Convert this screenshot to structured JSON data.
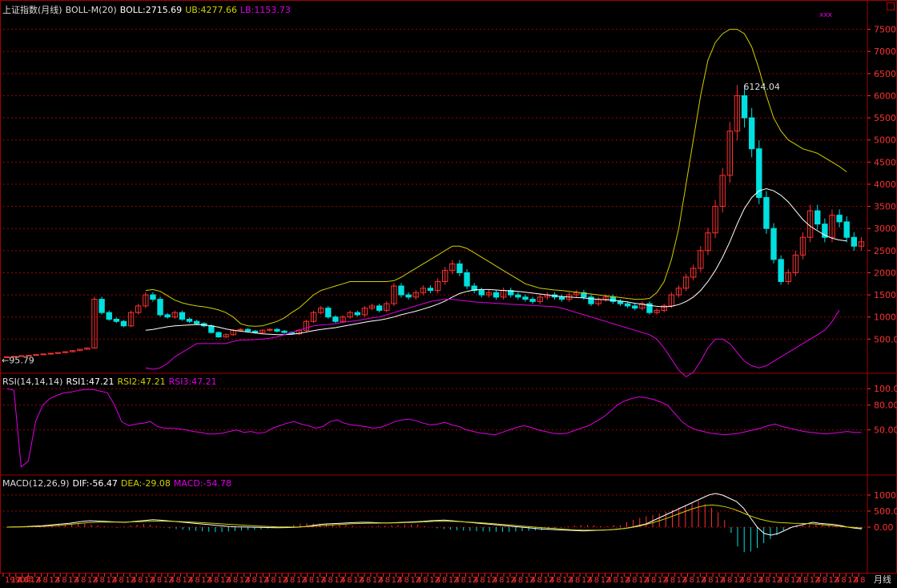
{
  "panes": {
    "main": {
      "title": "上证指数(月线)",
      "indicator": "BOLL-M(20)",
      "boll": "BOLL:2715.69",
      "ub": "UB:4277.66",
      "lb": "LB:1153.73",
      "high_label": "6124.04",
      "low_label": "←95.79",
      "tag": "xxx"
    },
    "rsi": {
      "title": "RSI(14,14,14)",
      "rsi1": "RSI1:47.21",
      "rsi2": "RSI2:47.21",
      "rsi3": "RSI3:47.21"
    },
    "macd": {
      "title": "MACD(12,26,9)",
      "dif": "DIF:-56.47",
      "dea": "DEA:-29.08",
      "macd": "MACD:-54.78"
    }
  },
  "colors": {
    "up": "#ff3030",
    "down": "#00e0e0",
    "boll": "#ffffff",
    "ub": "#d0d000",
    "lb": "#e000e0",
    "grid": "#a00000",
    "axis": "#ff3030"
  },
  "chart_data": [
    {
      "type": "candlestick",
      "pane": "main",
      "yticks": [
        500,
        1000,
        1500,
        2000,
        2500,
        3000,
        3500,
        4000,
        4500,
        5000,
        5500,
        6000,
        6500,
        7000,
        7500
      ],
      "ytick_labels": [
        "500.0",
        "1000",
        "1500",
        "2000",
        "2500",
        "3000",
        "3500",
        "4000",
        "4500",
        "5000",
        "5500",
        "6000",
        "6500",
        "7000",
        "7500"
      ],
      "ylim": [
        -200,
        7800
      ],
      "close": [
        100,
        110,
        125,
        135,
        150,
        165,
        180,
        195,
        215,
        240,
        270,
        300,
        1400,
        1100,
        950,
        900,
        800,
        1100,
        1250,
        1500,
        1400,
        1050,
        1000,
        1100,
        950,
        900,
        850,
        800,
        650,
        550,
        600,
        700,
        720,
        680,
        650,
        700,
        720,
        680,
        650,
        620,
        700,
        900,
        1100,
        1200,
        1000,
        900,
        1000,
        1100,
        1050,
        1200,
        1250,
        1150,
        1300,
        1700,
        1500,
        1450,
        1550,
        1650,
        1600,
        1800,
        2050,
        2200,
        2000,
        1700,
        1600,
        1500,
        1550,
        1450,
        1600,
        1500,
        1450,
        1400,
        1350,
        1450,
        1500,
        1450,
        1400,
        1500,
        1550,
        1450,
        1300,
        1400,
        1450,
        1350,
        1300,
        1250,
        1200,
        1300,
        1100,
        1150,
        1250,
        1500,
        1650,
        1900,
        2100,
        2500,
        2900,
        3500,
        4200,
        5200,
        6000,
        5500,
        4800,
        3700,
        3000,
        2300,
        1800,
        2000,
        2400,
        2800,
        3400,
        3100,
        2800,
        3300,
        3150,
        2800,
        2600,
        2700
      ],
      "boll": {
        "mid": [
          null,
          null,
          null,
          null,
          null,
          null,
          null,
          null,
          null,
          null,
          null,
          null,
          null,
          null,
          null,
          null,
          null,
          null,
          null,
          700,
          720,
          750,
          780,
          800,
          810,
          820,
          830,
          820,
          800,
          770,
          730,
          700,
          680,
          660,
          640,
          620,
          610,
          600,
          600,
          610,
          630,
          660,
          690,
          720,
          740,
          760,
          790,
          820,
          850,
          880,
          910,
          930,
          960,
          1000,
          1050,
          1090,
          1130,
          1180,
          1230,
          1290,
          1360,
          1450,
          1530,
          1580,
          1610,
          1620,
          1620,
          1610,
          1600,
          1590,
          1580,
          1560,
          1540,
          1520,
          1500,
          1480,
          1460,
          1450,
          1440,
          1430,
          1410,
          1400,
          1390,
          1380,
          1360,
          1340,
          1310,
          1290,
          1260,
          1240,
          1230,
          1240,
          1280,
          1350,
          1450,
          1600,
          1800,
          2050,
          2350,
          2700,
          3100,
          3450,
          3700,
          3850,
          3900,
          3850,
          3750,
          3600,
          3400,
          3200,
          3050,
          2950,
          2850,
          2780,
          2740,
          2720
        ],
        "ub": [
          null,
          null,
          null,
          null,
          null,
          null,
          null,
          null,
          null,
          null,
          null,
          null,
          null,
          null,
          null,
          null,
          null,
          null,
          null,
          1600,
          1620,
          1580,
          1480,
          1380,
          1320,
          1280,
          1250,
          1230,
          1200,
          1160,
          1100,
          1000,
          850,
          800,
          790,
          800,
          850,
          900,
          980,
          1100,
          1200,
          1350,
          1500,
          1600,
          1650,
          1700,
          1750,
          1800,
          1800,
          1800,
          1800,
          1800,
          1800,
          1820,
          1900,
          2000,
          2100,
          2200,
          2300,
          2400,
          2500,
          2600,
          2600,
          2550,
          2450,
          2350,
          2250,
          2150,
          2050,
          1950,
          1850,
          1750,
          1700,
          1650,
          1630,
          1610,
          1600,
          1580,
          1560,
          1540,
          1520,
          1500,
          1480,
          1460,
          1440,
          1420,
          1400,
          1400,
          1420,
          1550,
          1800,
          2300,
          3000,
          4000,
          5000,
          6000,
          6800,
          7200,
          7400,
          7500,
          7500,
          7400,
          7100,
          6600,
          6000,
          5500,
          5200,
          5000,
          4900,
          4800,
          4750,
          4700,
          4600,
          4500,
          4400,
          4280
        ],
        "lb": [
          null,
          null,
          null,
          null,
          null,
          null,
          null,
          null,
          null,
          null,
          null,
          null,
          null,
          null,
          null,
          null,
          null,
          null,
          null,
          -150,
          -180,
          -150,
          -50,
          100,
          200,
          300,
          400,
          400,
          400,
          400,
          400,
          450,
          480,
          480,
          490,
          500,
          520,
          550,
          600,
          650,
          700,
          750,
          800,
          820,
          830,
          850,
          880,
          900,
          920,
          950,
          980,
          1000,
          1050,
          1100,
          1150,
          1200,
          1250,
          1300,
          1350,
          1380,
          1400,
          1400,
          1380,
          1360,
          1340,
          1330,
          1320,
          1310,
          1300,
          1290,
          1280,
          1270,
          1260,
          1250,
          1240,
          1230,
          1200,
          1150,
          1100,
          1050,
          1000,
          950,
          900,
          850,
          800,
          750,
          700,
          650,
          600,
          500,
          300,
          50,
          -200,
          -350,
          -250,
          0,
          300,
          500,
          500,
          400,
          200,
          0,
          -100,
          -150,
          -100,
          0,
          100,
          200,
          300,
          400,
          500,
          600,
          700,
          900,
          1153
        ]
      }
    },
    {
      "type": "line",
      "pane": "rsi",
      "yticks": [
        50,
        80,
        100
      ],
      "ytick_labels": [
        "50.00",
        "80.00",
        "100.00"
      ],
      "ylim": [
        0,
        105
      ],
      "series": [
        {
          "values": [
            100,
            98,
            5,
            12,
            60,
            80,
            88,
            92,
            95,
            96,
            98,
            99,
            99,
            97,
            95,
            80,
            60,
            55,
            57,
            58,
            60,
            54,
            52,
            52,
            51,
            50,
            48,
            47,
            45,
            45,
            46,
            48,
            50,
            47,
            48,
            46,
            47,
            52,
            55,
            58,
            60,
            57,
            55,
            52,
            54,
            60,
            62,
            58,
            56,
            55,
            54,
            52,
            53,
            56,
            60,
            62,
            63,
            61,
            58,
            56,
            57,
            59,
            56,
            54,
            50,
            48,
            46,
            45,
            44,
            47,
            50,
            53,
            55,
            53,
            50,
            48,
            46,
            45,
            46,
            49,
            52,
            55,
            60,
            65,
            72,
            80,
            85,
            88,
            90,
            89,
            87,
            84,
            80,
            70,
            60,
            54,
            50,
            48,
            46,
            45,
            44,
            45,
            46,
            48,
            50,
            52,
            55,
            57,
            54,
            52,
            50,
            48,
            47,
            46,
            45,
            46,
            47,
            48,
            47,
            47
          ]
        }
      ]
    },
    {
      "type": "bar+line",
      "pane": "macd",
      "yticks": [
        0,
        500,
        1000
      ],
      "ytick_labels": [
        "0.00",
        "500.0",
        "1000"
      ],
      "ylim": [
        -1350,
        1300
      ],
      "series": [
        {
          "name": "DIF",
          "values": [
            0,
            5,
            10,
            20,
            30,
            40,
            60,
            80,
            100,
            120,
            150,
            180,
            200,
            190,
            180,
            170,
            160,
            150,
            170,
            190,
            210,
            230,
            220,
            200,
            180,
            160,
            140,
            120,
            100,
            80,
            60,
            40,
            20,
            10,
            5,
            0,
            -5,
            -10,
            -15,
            -20,
            -15,
            -10,
            0,
            20,
            50,
            80,
            100,
            110,
            120,
            130,
            140,
            150,
            150,
            140,
            130,
            130,
            140,
            150,
            160,
            170,
            180,
            200,
            210,
            220,
            200,
            180,
            160,
            140,
            120,
            100,
            80,
            60,
            40,
            20,
            0,
            -20,
            -40,
            -60,
            -70,
            -80,
            -90,
            -100,
            -110,
            -120,
            -110,
            -100,
            -90,
            -80,
            -60,
            -40,
            0,
            50,
            100,
            200,
            300,
            400,
            500,
            600,
            700,
            800,
            900,
            1000,
            1050,
            1000,
            900,
            800,
            600,
            300,
            0,
            -200,
            -250,
            -200,
            -100,
            0,
            50,
            100,
            150,
            120,
            100,
            80,
            50,
            0,
            -30,
            -56
          ]
        },
        {
          "name": "DEA",
          "values": [
            0,
            2,
            5,
            10,
            15,
            20,
            30,
            45,
            60,
            80,
            100,
            120,
            140,
            150,
            155,
            158,
            160,
            158,
            160,
            165,
            172,
            180,
            185,
            185,
            183,
            178,
            170,
            160,
            150,
            138,
            125,
            112,
            98,
            85,
            72,
            60,
            48,
            36,
            25,
            15,
            8,
            4,
            3,
            6,
            14,
            26,
            40,
            54,
            67,
            80,
            92,
            104,
            113,
            119,
            122,
            124,
            127,
            131,
            136,
            142,
            149,
            159,
            169,
            179,
            183,
            182,
            178,
            170,
            160,
            148,
            134,
            119,
            103,
            86,
            69,
            51,
            33,
            14,
            -3,
            -18,
            -33,
            -48,
            -63,
            -77,
            -87,
            -93,
            -96,
            -96,
            -92,
            -84,
            -67,
            -44,
            -15,
            22,
            70,
            125,
            187,
            256,
            330,
            410,
            490,
            565,
            630,
            675,
            690,
            670,
            630,
            570,
            490,
            400,
            320,
            250,
            200,
            160,
            140,
            130,
            120,
            115,
            110,
            100,
            80,
            60,
            40,
            20,
            0,
            -10,
            -29
          ]
        }
      ],
      "macd_bars": [
        0,
        5,
        10,
        20,
        30,
        40,
        60,
        70,
        80,
        80,
        100,
        120,
        120,
        80,
        50,
        24,
        0,
        -16,
        20,
        50,
        76,
        100,
        70,
        30,
        -6,
        -36,
        -60,
        -80,
        -100,
        -116,
        -130,
        -144,
        -156,
        -150,
        -134,
        -120,
        -106,
        -92,
        -80,
        -70,
        -46,
        -28,
        -6,
        28,
        72,
        108,
        120,
        112,
        106,
        100,
        96,
        92,
        74,
        42,
        16,
        12,
        26,
        38,
        48,
        56,
        62,
        82,
        82,
        82,
        34,
        -4,
        -36,
        -60,
        -80,
        -96,
        -108,
        -118,
        -126,
        -132,
        -138,
        -142,
        -146,
        -148,
        -134,
        -124,
        -114,
        -104,
        -94,
        -86,
        -46,
        -14,
        28,
        48,
        58,
        64,
        54,
        32,
        30,
        56,
        60,
        150,
        226,
        288,
        340,
        380,
        420,
        470,
        540,
        610,
        690,
        780,
        820,
        720,
        600,
        460,
        220,
        -180,
        -600,
        -780,
        -760,
        -650,
        -500,
        -370,
        -250,
        -100,
        -20,
        50,
        60,
        70,
        80,
        100,
        80,
        60,
        40,
        20,
        0,
        -55
      ]
    }
  ],
  "x_axis": {
    "labels": [
      "1990年",
      "12",
      "4",
      "8",
      "12",
      "4",
      "8",
      "12",
      "4",
      "8",
      "12",
      "4",
      "8",
      "12",
      "4",
      "8",
      "12",
      "4",
      "8",
      "12",
      "4",
      "8",
      "12",
      "4",
      "8",
      "12",
      "4",
      "8",
      "12",
      "4",
      "8",
      "12",
      "4",
      "8",
      "12",
      "4",
      "8",
      "12",
      "4",
      "8",
      "12",
      "4",
      "8",
      "12",
      "4",
      "8",
      "12",
      "4",
      "8",
      "12",
      "4",
      "8",
      "12",
      "4",
      "8",
      "12",
      "4",
      "8",
      "12",
      "4",
      "8",
      "12",
      "4",
      "8",
      "12",
      "4",
      "8",
      "12",
      "4",
      "8",
      "12",
      "4",
      "8",
      "12",
      "4",
      "8",
      "12",
      "4",
      "8",
      "12",
      "4",
      "8",
      "12",
      "4",
      "8",
      "12",
      "4",
      "8",
      "12",
      "4",
      "8",
      "12",
      "4",
      "8",
      "12",
      "4",
      "8",
      "12",
      "4",
      "8",
      "12",
      "4",
      "8",
      "12",
      "4",
      "8",
      "12",
      "4",
      "8",
      "12",
      "4",
      "8",
      "12",
      "4",
      "8",
      "12",
      "4",
      "8",
      "12",
      "4",
      "8",
      "12",
      "4",
      "8",
      "12",
      "4",
      "8",
      "12",
      "4",
      "8",
      "12",
      "4",
      "8",
      "12",
      "4",
      "8"
    ],
    "period": "月线"
  }
}
